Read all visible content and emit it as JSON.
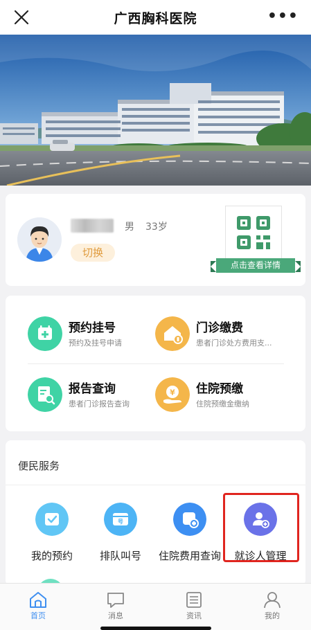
{
  "header": {
    "title": "广西胸科医院",
    "more_label": "•••"
  },
  "patient": {
    "gender": "男",
    "age": "33岁",
    "switch_label": "切换",
    "qr_label": "点击查看详情"
  },
  "services": [
    {
      "title": "预约挂号",
      "subtitle": "预约及挂号申请",
      "color": "#3fd3a5"
    },
    {
      "title": "门诊缴费",
      "subtitle": "患者门诊处方费用支...",
      "color": "#f4b64a"
    },
    {
      "title": "报告查询",
      "subtitle": "患者门诊报告查询",
      "color": "#3fd3a5"
    },
    {
      "title": "住院预缴",
      "subtitle": "住院预缴金缴纳",
      "color": "#f4b64a"
    }
  ],
  "convenience": {
    "heading": "便民服务",
    "items": [
      {
        "label": "我的预约",
        "color": "#61c6f5"
      },
      {
        "label": "排队叫号",
        "color": "#4db4f5"
      },
      {
        "label": "住院费用查询",
        "color": "#3d8ff2"
      },
      {
        "label": "就诊人管理",
        "color": "#6a72e8"
      }
    ]
  },
  "tabbar": [
    {
      "label": "首页",
      "active": true
    },
    {
      "label": "消息",
      "active": false
    },
    {
      "label": "资讯",
      "active": false
    },
    {
      "label": "我的",
      "active": false
    }
  ]
}
